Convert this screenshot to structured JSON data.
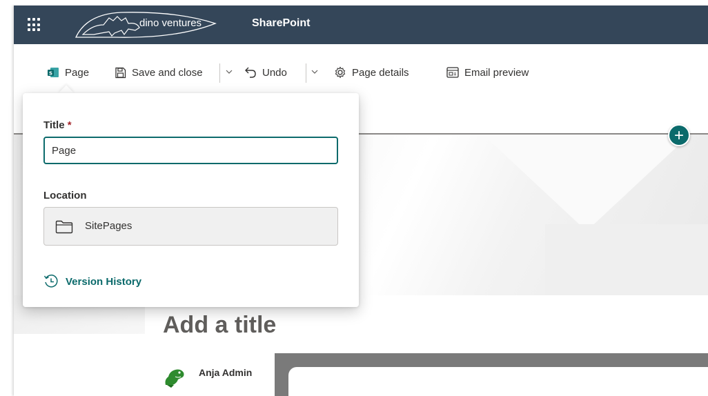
{
  "suitebar": {
    "logo_text": "dino ventures",
    "app_name": "SharePoint"
  },
  "commandbar": {
    "page_label": "Page",
    "save_close_label": "Save and close",
    "undo_label": "Undo",
    "page_details_label": "Page details",
    "email_preview_label": "Email preview"
  },
  "panel": {
    "title_label": "Title",
    "required_mark": "*",
    "title_value": "Page",
    "location_label": "Location",
    "location_value": "SitePages",
    "version_history_label": "Version History"
  },
  "canvas": {
    "page_title_placeholder": "Add a title",
    "author_name": "Anja Admin"
  },
  "colors": {
    "suitebar_bg": "#344659",
    "accent": "#0b6a6b",
    "required": "#a4262c"
  }
}
